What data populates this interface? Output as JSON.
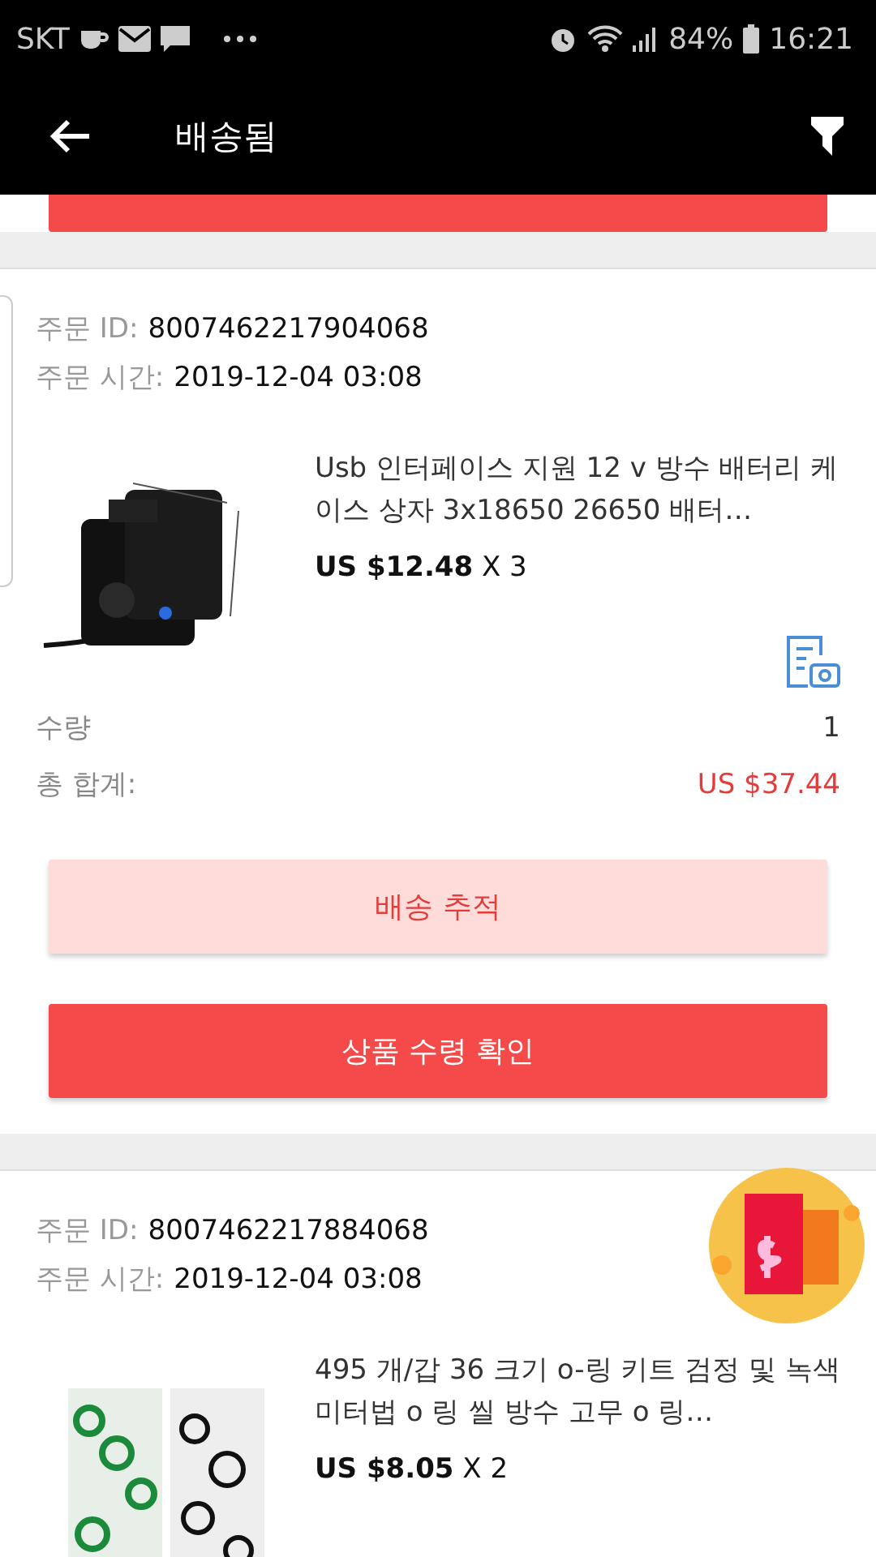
{
  "status_bar": {
    "carrier": "SKT",
    "battery": "84%",
    "time": "16:21"
  },
  "app_bar": {
    "title": "배송됨"
  },
  "orders": [
    {
      "id_label": "주문 ID:",
      "id": "8007462217904068",
      "time_label": "주문 시간:",
      "time": "2019-12-04 03:08",
      "product": {
        "title": "Usb 인터페이스 지원 12 v 방수 배터리 케이스 상자 3x18650 26650 배터…",
        "price": "US $12.48",
        "qty": "X 3",
        "kind": "battery"
      },
      "quantity_label": "수량",
      "quantity": "1",
      "total_label": "총 합계:",
      "total": "US $37.44",
      "buttons": [
        {
          "label": "배송 추적",
          "kind": "secondary"
        },
        {
          "label": "상품 수령 확인",
          "kind": "primary"
        }
      ]
    },
    {
      "id_label": "주문 ID:",
      "id": "8007462217884068",
      "time_label": "주문 시간:",
      "time": "2019-12-04 03:08",
      "product": {
        "title": "495 개/갑 36 크기 o-링 키트 검정 및 녹색 미터법 o 링 씰 방수 고무 o 링…",
        "price": "US $8.05",
        "qty": "X 2",
        "kind": "rings"
      }
    }
  ]
}
